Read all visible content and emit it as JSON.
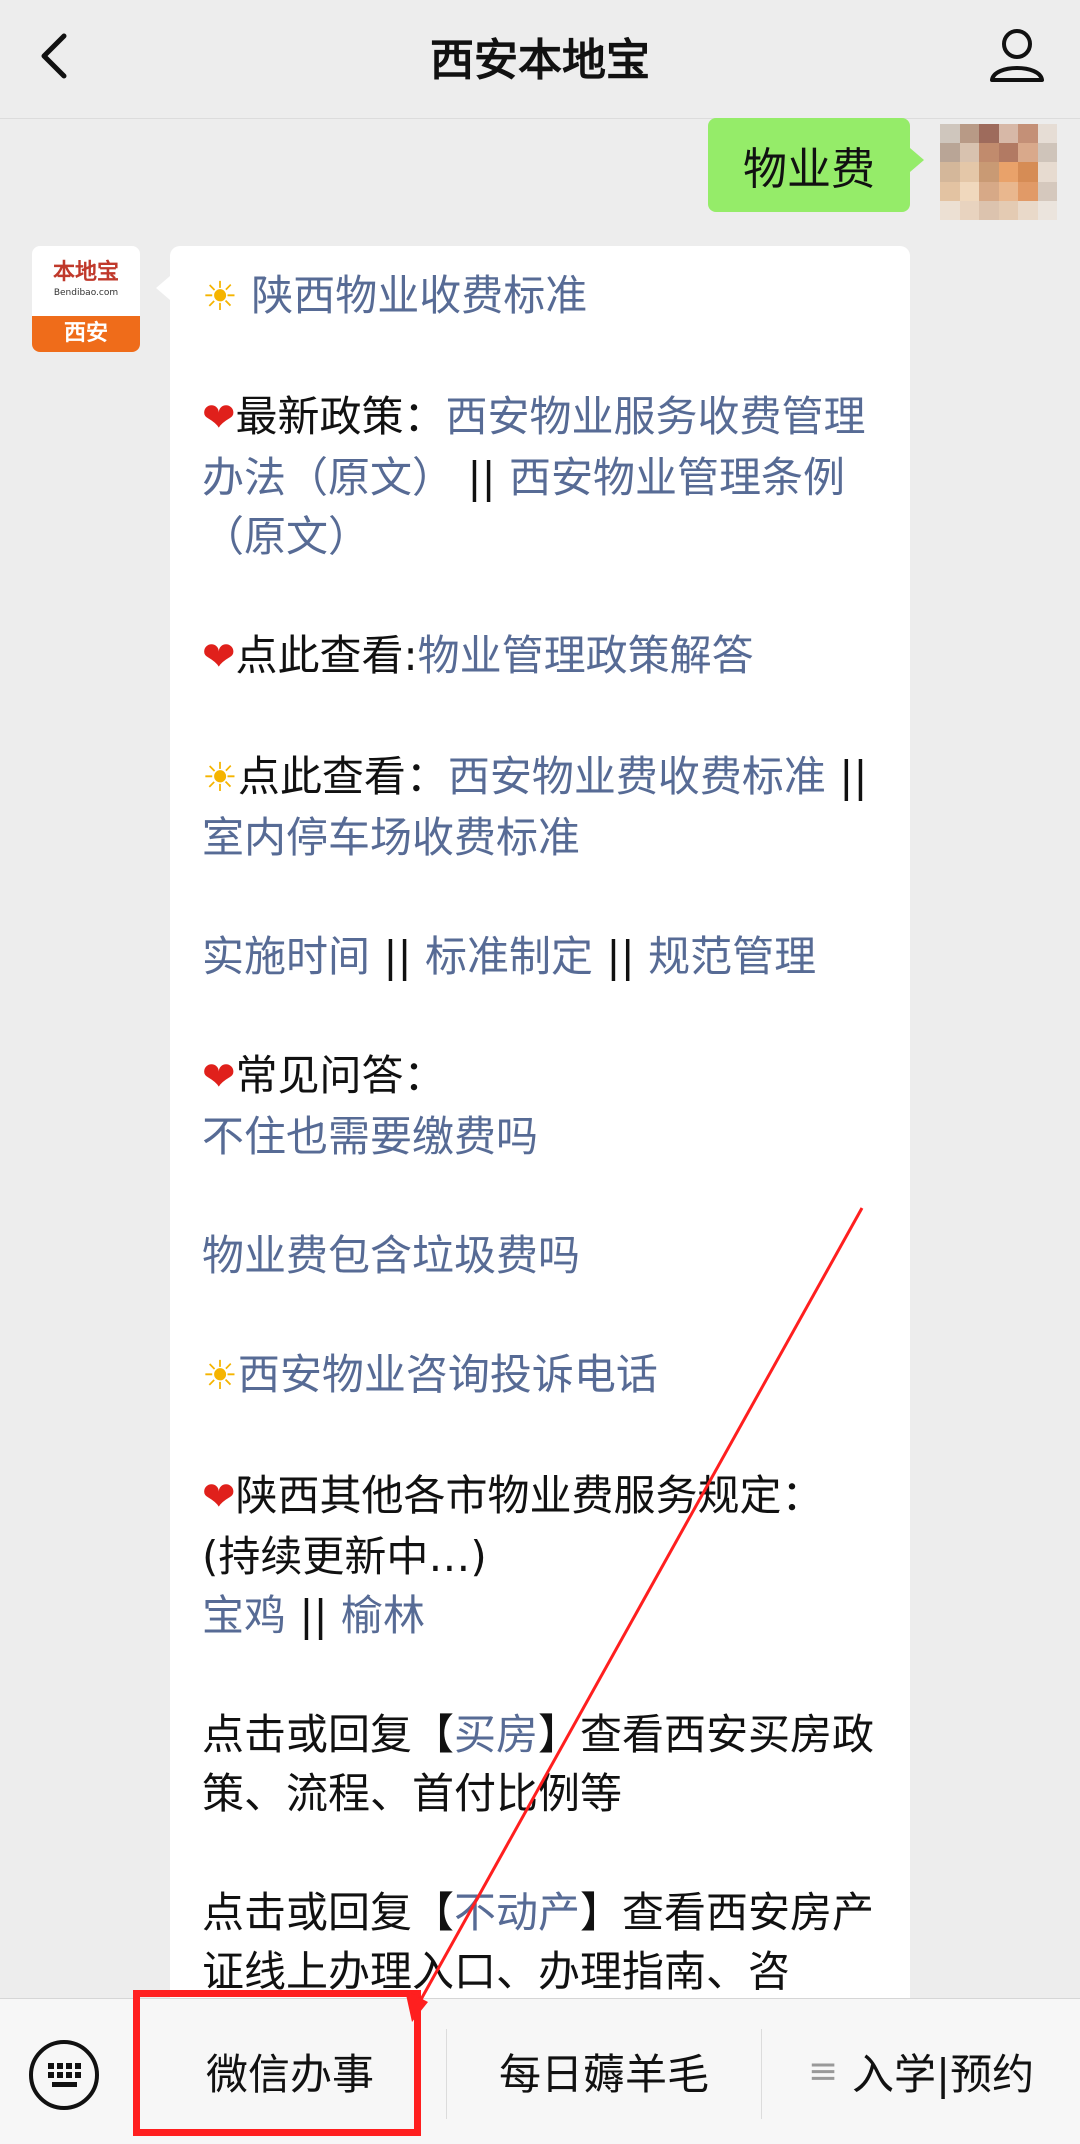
{
  "header": {
    "title": "西安本地宝"
  },
  "chat": {
    "user_message": "物业费",
    "bot_avatar": {
      "logo_cn": "本地宝",
      "logo_en": "Bendibao.com",
      "city": "西安"
    },
    "bot_message": {
      "b1_link": "陕西物业收费标准",
      "b2_text": "最新政策：",
      "b2_link1": "西安物业服务收费管理办法（原文）",
      "b2_sep": "||",
      "b2_link2": "西安物业管理条例（原文）",
      "b3_text": "点此查看:",
      "b3_link": "物业管理政策解答",
      "b4_text": "点此查看：",
      "b4_link1": "西安物业费收费标准",
      "b4_sep": "||",
      "b4_link2": "室内停车场收费标准",
      "b5_link1": "实施时间",
      "b5_sep1": "||",
      "b5_link2": "标准制定",
      "b5_sep2": "||",
      "b5_link3": "规范管理",
      "b6_text": "常见问答：",
      "b6_link": "不住也需要缴费吗",
      "b7_link": "物业费包含垃圾费吗",
      "b8_link": "西安物业咨询投诉电话",
      "b9_text1": "陕西其他各市物业费服务规定：",
      "b9_text2": "(持续更新中…)",
      "b9_link1": "宝鸡",
      "b9_sep": "||",
      "b9_link2": "榆林",
      "b10_pre": "点击或回复【",
      "b10_link": "买房",
      "b10_post": "】查看西安买房政策、流程、首付比例等",
      "b11_pre": "点击或回复【",
      "b11_link": "不动产",
      "b11_post": "】查看西安房产证线上办理入口、办理指南、咨"
    }
  },
  "bottom_menu": {
    "item1": "微信办事",
    "item2": "每日薅羊毛",
    "item3": "入学|预约"
  },
  "emoji": {
    "sun": "☀",
    "heart": "❤"
  },
  "colors": {
    "link": "#576b95",
    "user_bubble": "#95ec69",
    "annotation": "#ff1f1f",
    "logo_orange": "#ef6c1a"
  },
  "icons": [
    "back-arrow-icon",
    "person-icon",
    "keyboard-icon",
    "menu-lines-icon"
  ]
}
